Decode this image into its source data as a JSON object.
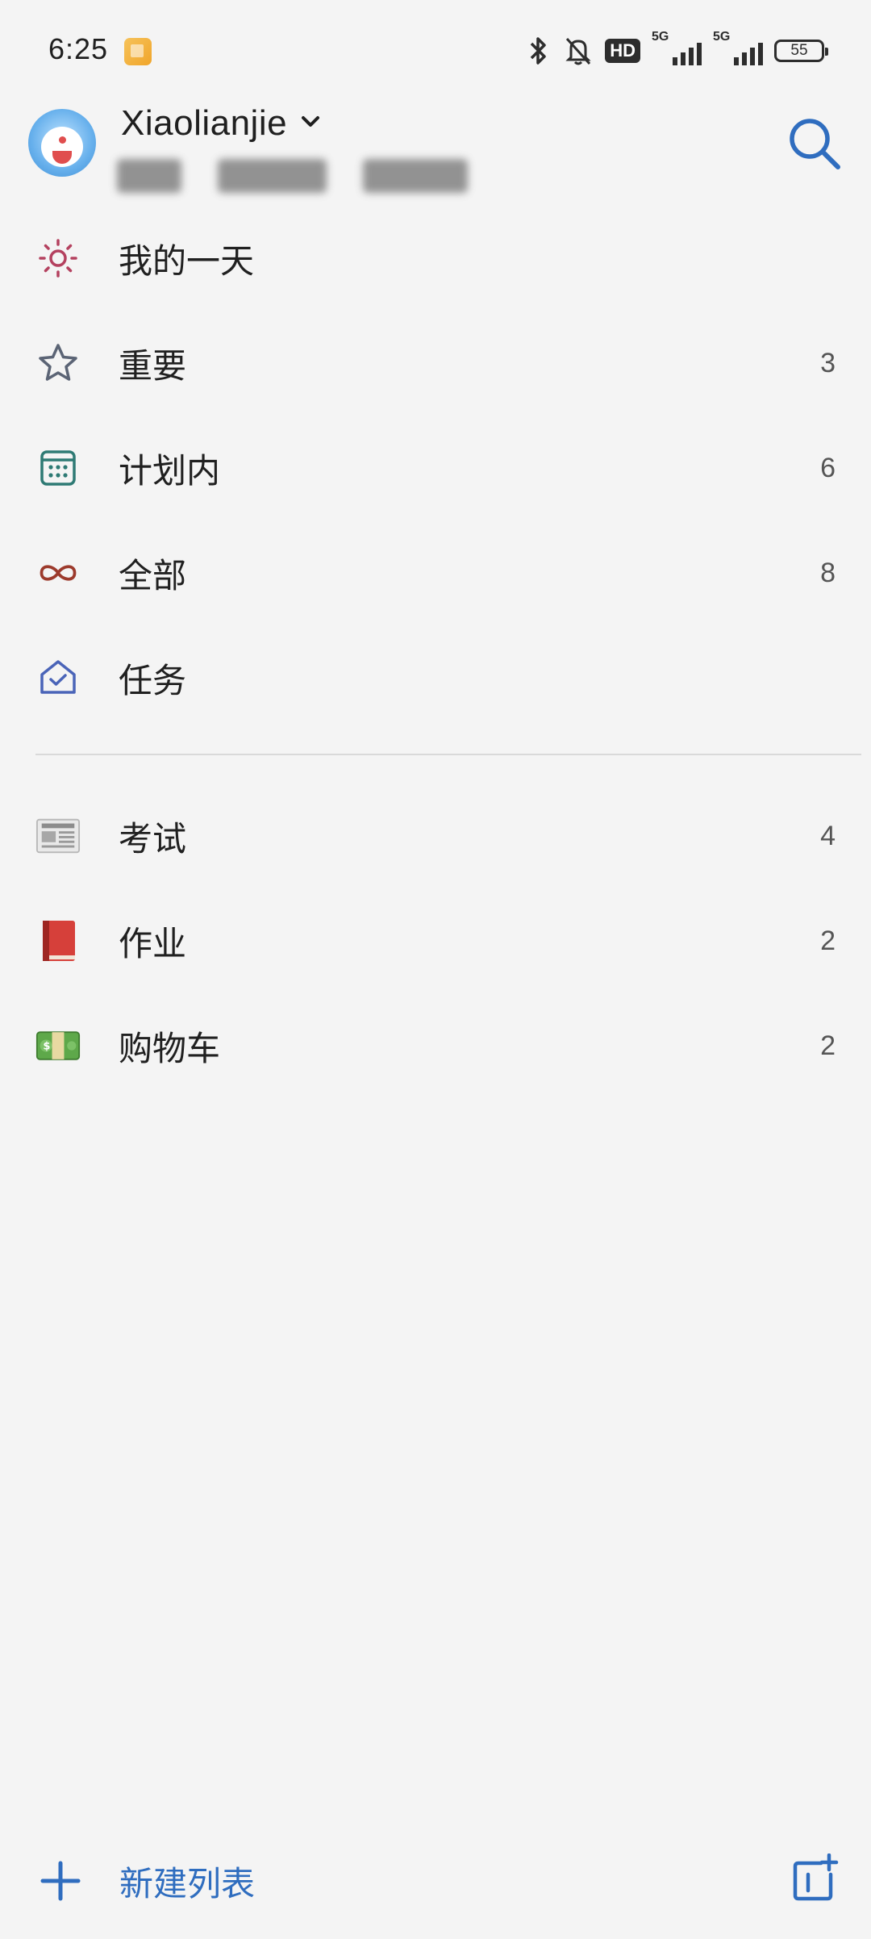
{
  "status_bar": {
    "time": "6:25",
    "hd_label": "HD",
    "signal_1": "5G",
    "signal_2": "5G",
    "battery": "55"
  },
  "account": {
    "name": "Xiaolianjie",
    "dropdown_icon": "chevron-down-icon"
  },
  "smart_lists": [
    {
      "label": "我的一天",
      "count": "",
      "icon": "sun-icon",
      "color": "#b4415f"
    },
    {
      "label": "重要",
      "count": "3",
      "icon": "star-icon",
      "color": "#5b6475"
    },
    {
      "label": "计划内",
      "count": "6",
      "icon": "calendar-icon",
      "color": "#2e7a74"
    },
    {
      "label": "全部",
      "count": "8",
      "icon": "infinity-icon",
      "color": "#9c3a2c"
    },
    {
      "label": "任务",
      "count": "",
      "icon": "home-check-icon",
      "color": "#4a64b8"
    }
  ],
  "custom_lists": [
    {
      "label": "考试",
      "count": "4",
      "icon": "newspaper-icon"
    },
    {
      "label": "作业",
      "count": "2",
      "icon": "red-book-icon"
    },
    {
      "label": "购物车",
      "count": "2",
      "icon": "dollar-banknote-icon"
    }
  ],
  "footer": {
    "new_list_label": "新建列表"
  },
  "colors": {
    "accent": "#2f6dbf",
    "background": "#f4f4f4"
  }
}
